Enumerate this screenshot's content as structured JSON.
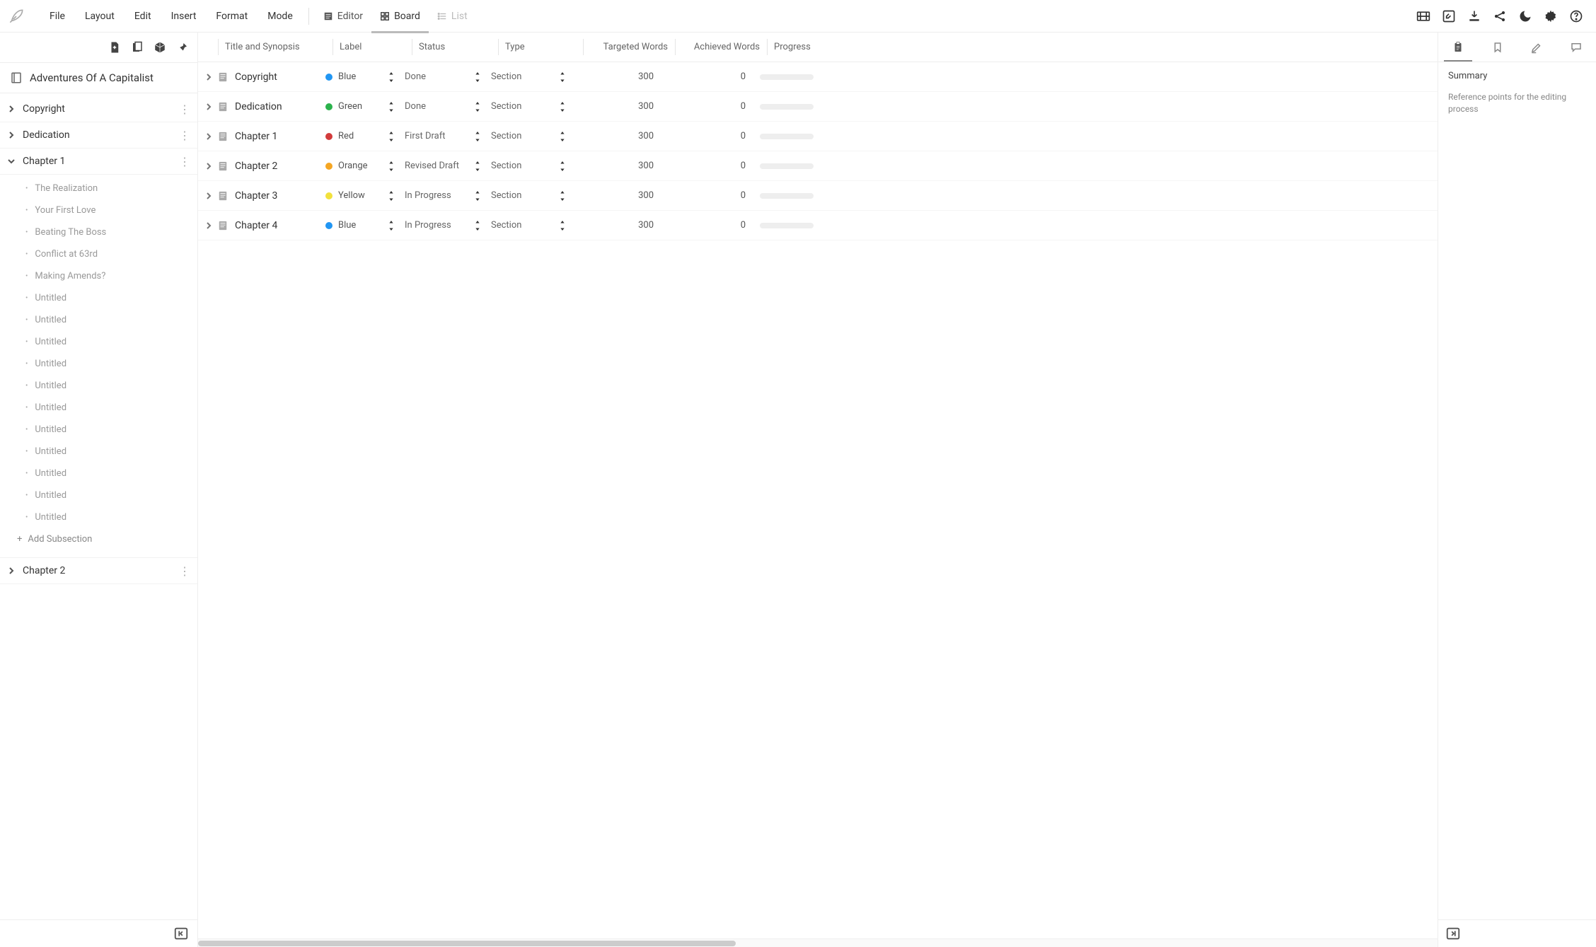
{
  "menus": [
    "File",
    "Layout",
    "Edit",
    "Insert",
    "Format",
    "Mode"
  ],
  "viewTabs": [
    {
      "label": "Editor",
      "active": false,
      "disabled": false
    },
    {
      "label": "Board",
      "active": true,
      "disabled": false
    },
    {
      "label": "List",
      "active": false,
      "disabled": true
    }
  ],
  "project": {
    "title": "Adventures Of A Capitalist"
  },
  "sidebar": {
    "sections": [
      {
        "label": "Copyright",
        "expanded": false
      },
      {
        "label": "Dedication",
        "expanded": false
      },
      {
        "label": "Chapter 1",
        "expanded": true,
        "children": [
          "The Realization",
          "Your First Love",
          "Beating The Boss",
          "Conflict at 63rd",
          "Making Amends?",
          "Untitled",
          "Untitled",
          "Untitled",
          "Untitled",
          "Untitled",
          "Untitled",
          "Untitled",
          "Untitled",
          "Untitled",
          "Untitled",
          "Untitled"
        ],
        "addLabel": "Add Subsection"
      },
      {
        "label": "Chapter 2",
        "expanded": false
      }
    ]
  },
  "columns": [
    "Title and Synopsis",
    "Label",
    "Status",
    "Type",
    "Targeted Words",
    "Achieved Words",
    "Progress"
  ],
  "labelColors": {
    "Blue": "#2196f3",
    "Green": "#2bb24c",
    "Red": "#d23b3b",
    "Orange": "#f5a623",
    "Yellow": "#f2e13c"
  },
  "rows": [
    {
      "title": "Copyright",
      "label": "Blue",
      "status": "Done",
      "type": "Section",
      "target": 300,
      "achieved": 0
    },
    {
      "title": "Dedication",
      "label": "Green",
      "status": "Done",
      "type": "Section",
      "target": 300,
      "achieved": 0
    },
    {
      "title": "Chapter 1",
      "label": "Red",
      "status": "First Draft",
      "type": "Section",
      "target": 300,
      "achieved": 0
    },
    {
      "title": "Chapter 2",
      "label": "Orange",
      "status": "Revised Draft",
      "type": "Section",
      "target": 300,
      "achieved": 0
    },
    {
      "title": "Chapter 3",
      "label": "Yellow",
      "status": "In Progress",
      "type": "Section",
      "target": 300,
      "achieved": 0
    },
    {
      "title": "Chapter 4",
      "label": "Blue",
      "status": "In Progress",
      "type": "Section",
      "target": 300,
      "achieved": 0
    }
  ],
  "rightPanel": {
    "heading": "Summary",
    "text": "Reference points for the editing process"
  }
}
